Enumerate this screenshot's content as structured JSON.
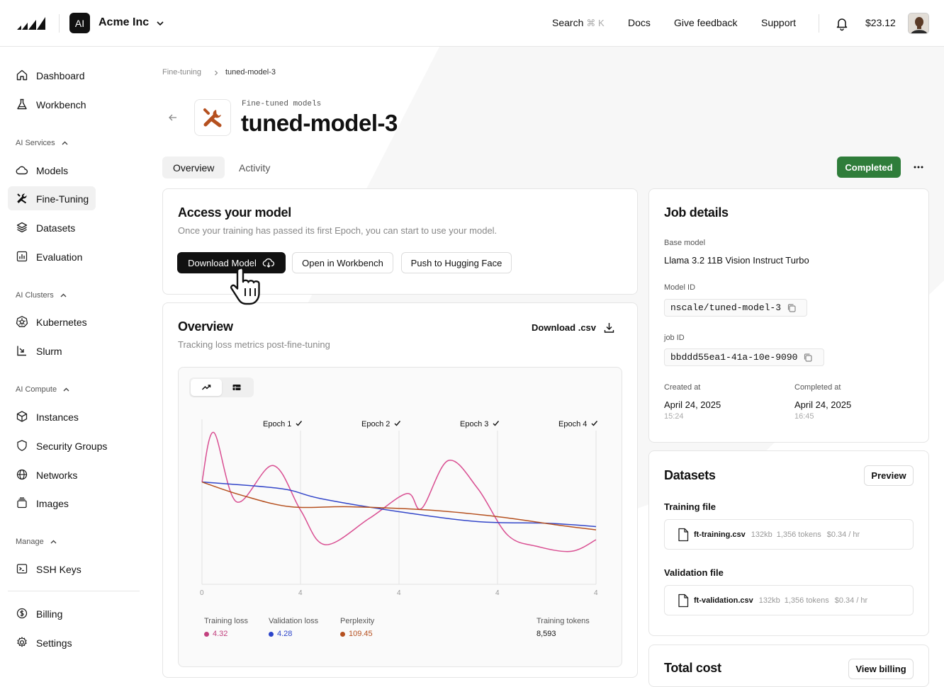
{
  "header": {
    "org_badge": "AI",
    "org_name": "Acme Inc",
    "nav": [
      {
        "label": "Search",
        "shortcut": "⌘ K"
      },
      {
        "label": "Docs"
      },
      {
        "label": "Give feedback"
      },
      {
        "label": "Support"
      }
    ],
    "balance": "$23.12"
  },
  "sidebar": {
    "items_top": [
      {
        "label": "Dashboard",
        "icon": "home-icon"
      },
      {
        "label": "Workbench",
        "icon": "flask-icon"
      }
    ],
    "groups": [
      {
        "label": "AI Services",
        "items": [
          {
            "label": "Models",
            "icon": "cloud-icon"
          },
          {
            "label": "Fine-Tuning",
            "icon": "tools-icon",
            "active": true
          },
          {
            "label": "Datasets",
            "icon": "layers-icon"
          },
          {
            "label": "Evaluation",
            "icon": "bar-chart-icon"
          }
        ]
      },
      {
        "label": "AI Clusters",
        "items": [
          {
            "label": "Kubernetes",
            "icon": "helm-icon"
          },
          {
            "label": "Slurm",
            "icon": "slurm-icon"
          }
        ]
      },
      {
        "label": "AI Compute",
        "items": [
          {
            "label": "Instances",
            "icon": "cube-icon"
          },
          {
            "label": "Security Groups",
            "icon": "shield-icon"
          },
          {
            "label": "Networks",
            "icon": "globe-icon"
          },
          {
            "label": "Images",
            "icon": "stack-icon"
          }
        ]
      },
      {
        "label": "Manage",
        "items": [
          {
            "label": "SSH Keys",
            "icon": "terminal-icon"
          }
        ]
      }
    ],
    "items_bottom": [
      {
        "label": "Billing",
        "icon": "dollar-icon"
      },
      {
        "label": "Settings",
        "icon": "gear-icon"
      }
    ]
  },
  "breadcrumb": {
    "parent": "Fine-tuning",
    "current": "tuned-model-3"
  },
  "page": {
    "eyebrow": "Fine-tuned models",
    "title": "tuned-model-3",
    "tabs": [
      "Overview",
      "Activity"
    ],
    "status": "Completed",
    "status_color": "#2f7d3a"
  },
  "access": {
    "title": "Access your model",
    "subtitle": "Once your training has passed its first Epoch, you can start to use your model.",
    "buttons": [
      "Download Model",
      "Open in Workbench",
      "Push to Hugging Face"
    ]
  },
  "overview": {
    "title": "Overview",
    "subtitle": "Tracking loss metrics post-fine-tuning",
    "download_label": "Download .csv",
    "legend": [
      {
        "label": "Training loss",
        "value": "4.32",
        "color": "#c2407e"
      },
      {
        "label": "Validation loss",
        "value": "4.28",
        "color": "#2b44c9"
      },
      {
        "label": "Perplexity",
        "value": "109.45",
        "color": "#b5501f"
      }
    ],
    "tokens_label": "Training tokens",
    "tokens_value": "8,593"
  },
  "chart_data": {
    "type": "line",
    "epochs": [
      "Epoch 1",
      "Epoch 2",
      "Epoch 3",
      "Epoch 4"
    ],
    "x_ticks": [
      "0",
      "4",
      "4",
      "4",
      "4"
    ],
    "series": [
      {
        "name": "Training loss",
        "color": "#d94f92",
        "x": [
          0,
          0.12,
          0.35,
          0.72,
          1.0,
          1.25,
          1.7,
          2.08,
          2.23,
          2.5,
          2.8,
          3.1,
          3.4,
          3.75,
          4.0
        ],
        "y": [
          0.62,
          0.92,
          0.5,
          0.72,
          0.45,
          0.24,
          0.4,
          0.55,
          0.46,
          0.75,
          0.58,
          0.3,
          0.23,
          0.2,
          0.27
        ]
      },
      {
        "name": "Validation loss",
        "color": "#3346c9",
        "x": [
          0,
          0.8,
          1.2,
          2.0,
          2.8,
          3.5,
          4.0
        ],
        "y": [
          0.62,
          0.58,
          0.52,
          0.44,
          0.38,
          0.37,
          0.35
        ]
      },
      {
        "name": "Perplexity",
        "color": "#b5501f",
        "x": [
          0,
          0.4,
          0.9,
          1.5,
          2.3,
          3.0,
          3.6,
          4.0
        ],
        "y": [
          0.62,
          0.54,
          0.47,
          0.47,
          0.45,
          0.41,
          0.36,
          0.33
        ]
      }
    ],
    "ylim": [
      0,
      1
    ],
    "xlim": [
      0,
      4
    ]
  },
  "job": {
    "title": "Job details",
    "base_model_label": "Base model",
    "base_model": "Llama 3.2 11B Vision Instruct Turbo",
    "model_id_label": "Model ID",
    "model_id": "nscale/tuned-model-3",
    "job_id_label": "job ID",
    "job_id": "bbddd55ea1-41a-10e-9090",
    "created_label": "Created at",
    "created_date": "April 24, 2025",
    "created_time": "15:24",
    "completed_label": "Completed at",
    "completed_date": "April 24, 2025",
    "completed_time": "16:45"
  },
  "datasets": {
    "title": "Datasets",
    "preview": "Preview",
    "training_label": "Training file",
    "training_file": {
      "name": "ft-training.csv",
      "size": "132kb",
      "tokens": "1,356 tokens",
      "rate": "$0.34 / hr"
    },
    "validation_label": "Validation file",
    "validation_file": {
      "name": "ft-validation.csv",
      "size": "132kb",
      "tokens": "1,356 tokens",
      "rate": "$0.34 / hr"
    }
  },
  "cost": {
    "title": "Total cost",
    "view_billing": "View billing"
  }
}
